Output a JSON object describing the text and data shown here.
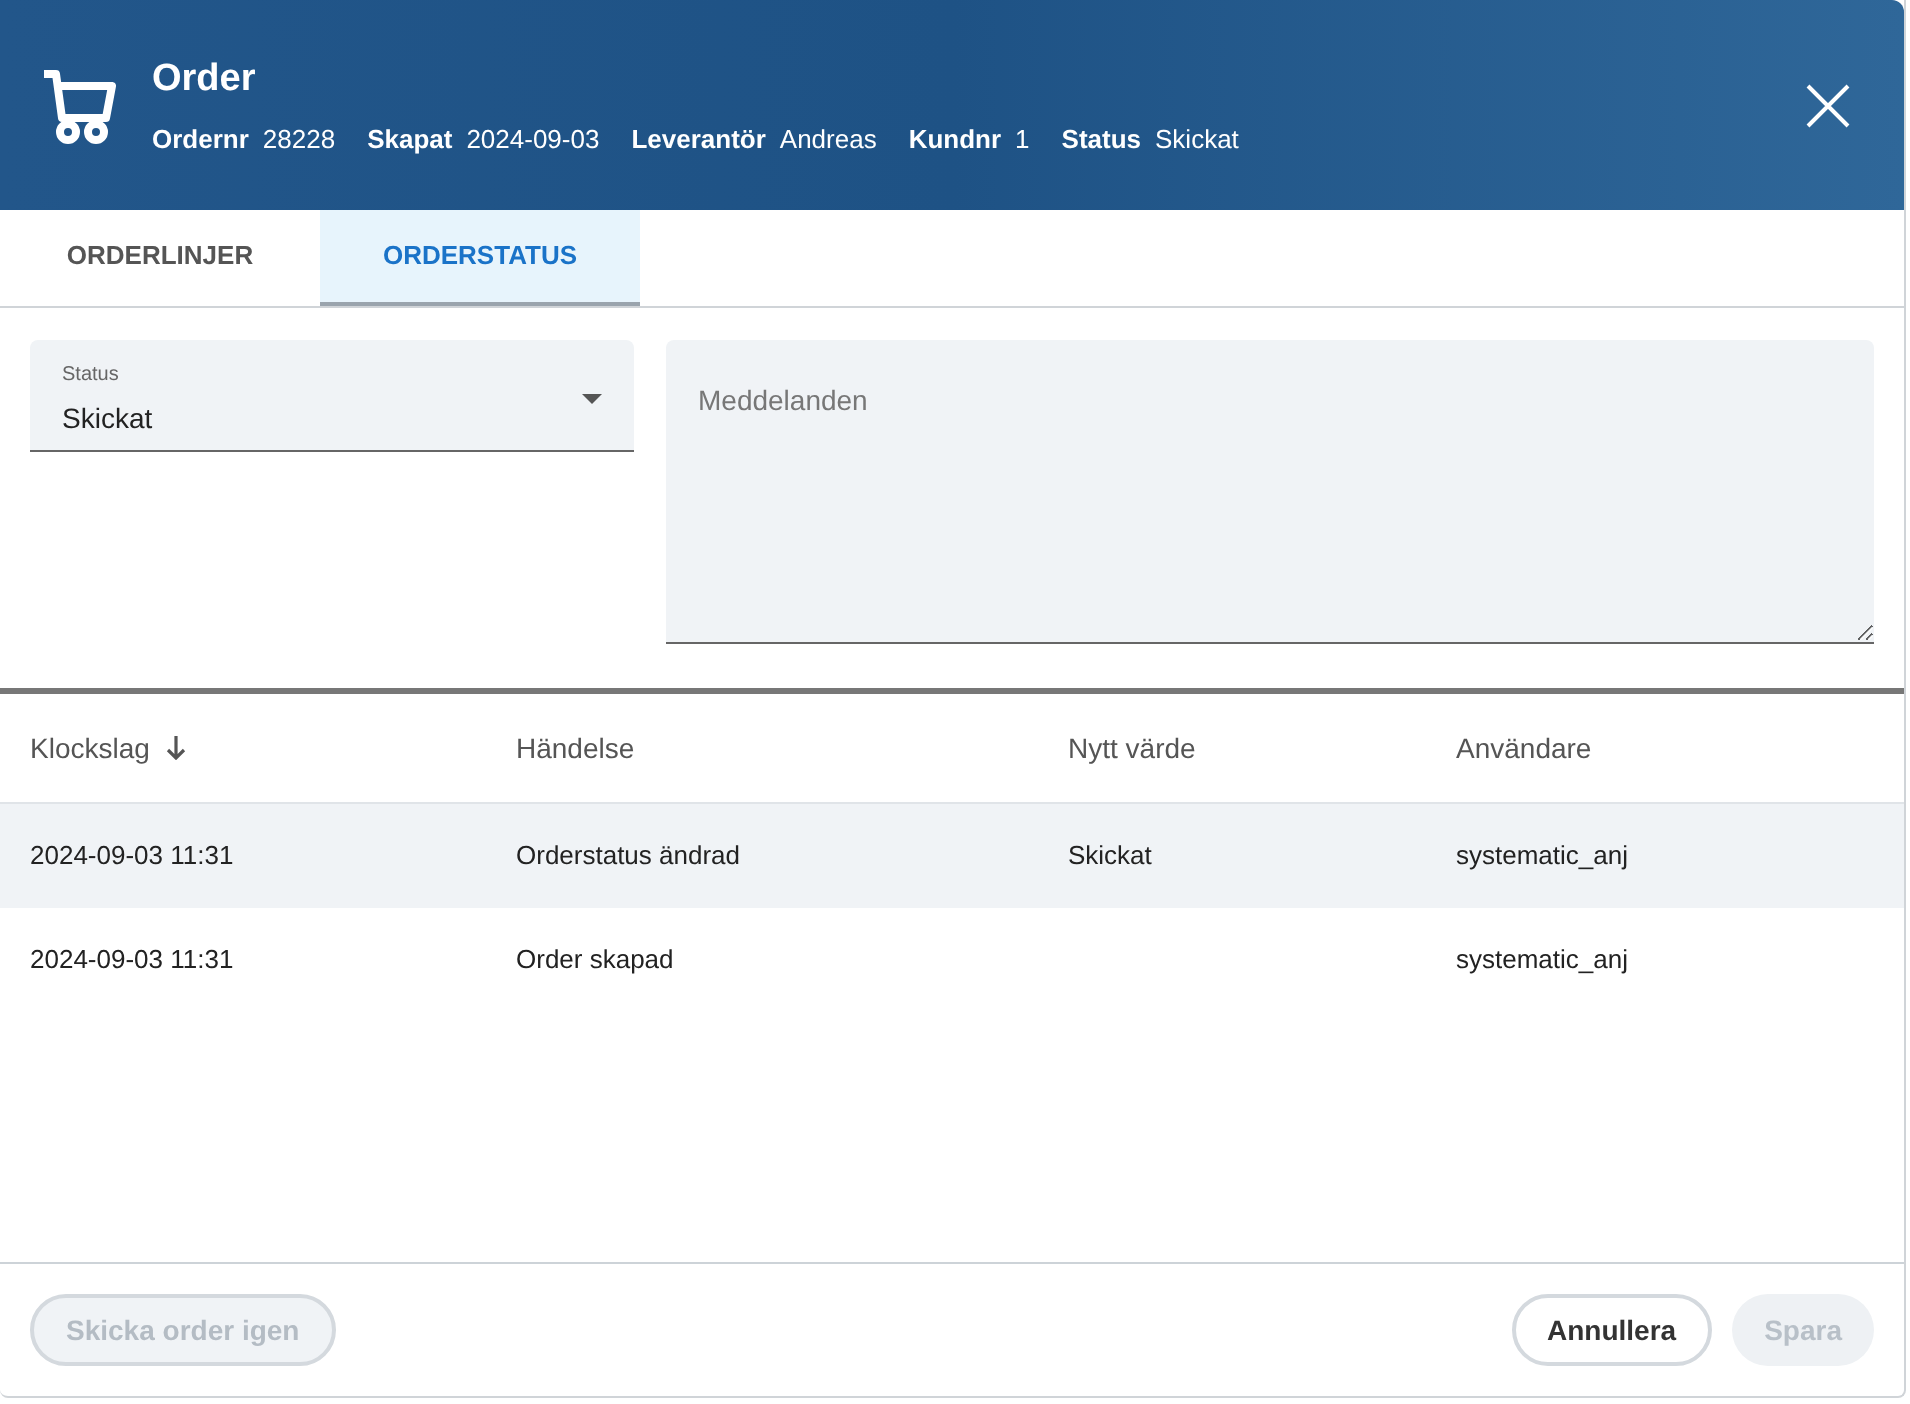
{
  "header": {
    "title": "Order",
    "meta": [
      {
        "label": "Ordernr",
        "value": "28228"
      },
      {
        "label": "Skapat",
        "value": "2024-09-03"
      },
      {
        "label": "Leverantör",
        "value": "Andreas"
      },
      {
        "label": "Kundnr",
        "value": "1"
      },
      {
        "label": "Status",
        "value": "Skickat"
      }
    ]
  },
  "tabs": [
    {
      "label": "ORDERLINJER",
      "selected": false
    },
    {
      "label": "ORDERSTATUS",
      "selected": true
    }
  ],
  "status_field": {
    "label": "Status",
    "value": "Skickat"
  },
  "messages_field": {
    "placeholder": "Meddelanden"
  },
  "table": {
    "columns": [
      {
        "label": "Klockslag",
        "sorted": true
      },
      {
        "label": "Händelse",
        "sorted": false
      },
      {
        "label": "Nytt värde",
        "sorted": false
      },
      {
        "label": "Användare",
        "sorted": false
      }
    ],
    "rows": [
      {
        "selected": true,
        "cells": [
          "2024-09-03 11:31",
          "Orderstatus ändrad",
          "Skickat",
          "systematic_anj"
        ]
      },
      {
        "selected": false,
        "cells": [
          "2024-09-03 11:31",
          "Order skapad",
          "",
          "systematic_anj"
        ]
      }
    ]
  },
  "footer": {
    "resend": {
      "label": "Skicka order igen",
      "disabled": true
    },
    "cancel": {
      "label": "Annullera",
      "disabled": false
    },
    "save": {
      "label": "Spara",
      "disabled": true
    }
  }
}
